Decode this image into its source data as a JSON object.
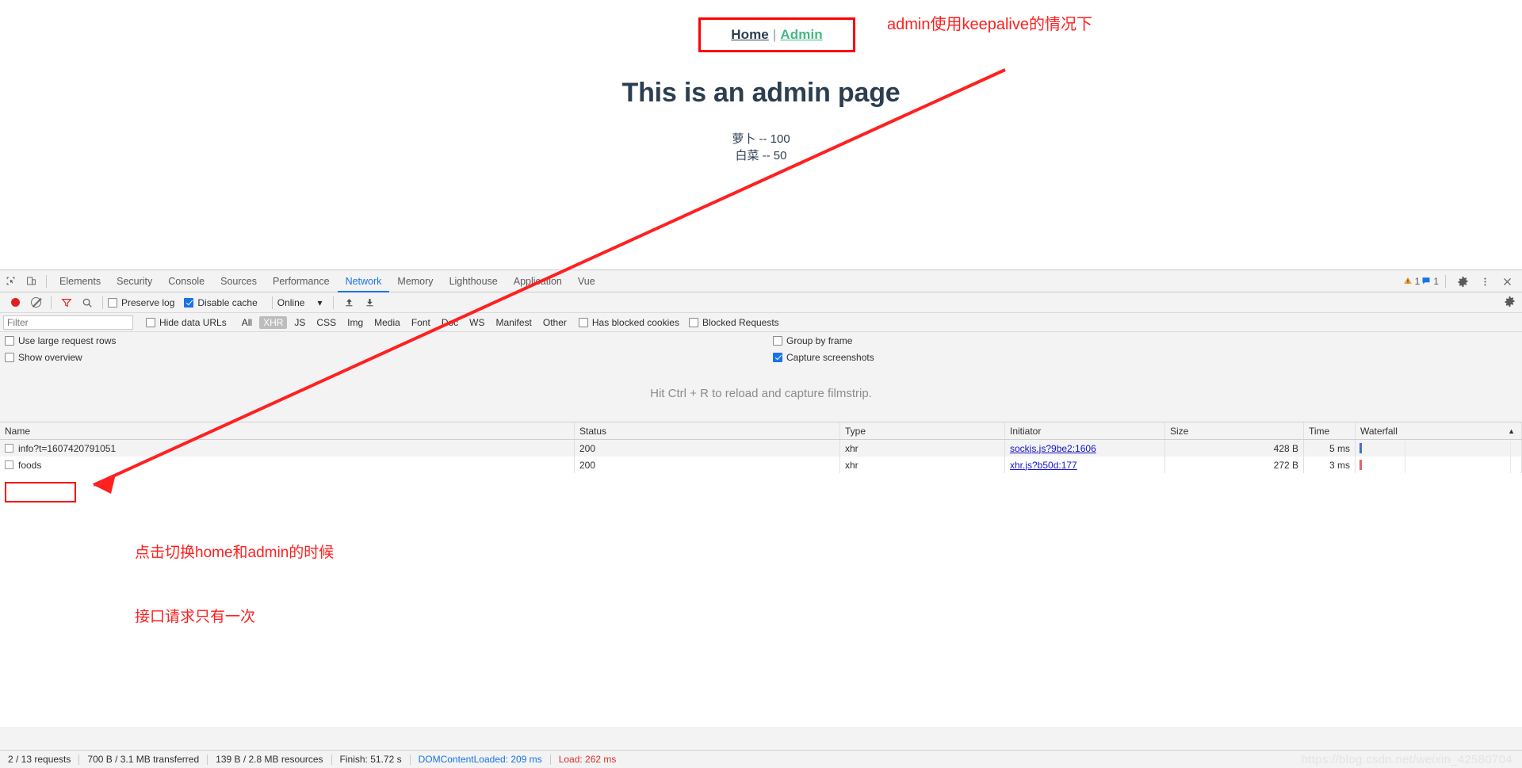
{
  "page": {
    "nav": {
      "home_label": "Home",
      "separator": "|",
      "admin_label": "Admin"
    },
    "heading": "This is an admin page",
    "foods": [
      "萝卜 -- 100",
      "白菜 -- 50"
    ]
  },
  "annotations": {
    "top": "admin使用keepalive的情况下",
    "bottom_line1": "点击切换home和admin的时候",
    "bottom_line2": "接口请求只有一次",
    "color": "#ff2020"
  },
  "devtools": {
    "tabs": [
      {
        "label": "Elements",
        "active": false
      },
      {
        "label": "Security",
        "active": false
      },
      {
        "label": "Console",
        "active": false
      },
      {
        "label": "Sources",
        "active": false
      },
      {
        "label": "Performance",
        "active": false
      },
      {
        "label": "Network",
        "active": true
      },
      {
        "label": "Memory",
        "active": false
      },
      {
        "label": "Lighthouse",
        "active": false
      },
      {
        "label": "Application",
        "active": false
      },
      {
        "label": "Vue",
        "active": false
      }
    ],
    "tabbar_right": {
      "warning_count": "1",
      "message_count": "1",
      "warning_icon": "warning-triangle-icon",
      "message_icon": "message-bubble-icon",
      "settings_icon": "gear-icon",
      "more_icon": "kebab-menu-icon",
      "close_icon": "close-icon"
    },
    "toolbar": {
      "record_icon": "record-dot-icon",
      "clear_icon": "clear-icon",
      "filter_icon": "funnel-icon",
      "search_icon": "search-icon",
      "preserve_log_label": "Preserve log",
      "preserve_log_checked": false,
      "disable_cache_label": "Disable cache",
      "disable_cache_checked": true,
      "throttle_value": "Online",
      "import_icon": "upload-arrow-icon",
      "export_icon": "download-arrow-icon",
      "settings_icon": "gear-icon"
    },
    "filterbar": {
      "filter_placeholder": "Filter",
      "filter_value": "",
      "hide_data_urls_label": "Hide data URLs",
      "hide_data_urls_checked": false,
      "types": [
        {
          "label": "All",
          "selected": false
        },
        {
          "label": "XHR",
          "selected": true
        },
        {
          "label": "JS",
          "selected": false
        },
        {
          "label": "CSS",
          "selected": false
        },
        {
          "label": "Img",
          "selected": false
        },
        {
          "label": "Media",
          "selected": false
        },
        {
          "label": "Font",
          "selected": false
        },
        {
          "label": "Doc",
          "selected": false
        },
        {
          "label": "WS",
          "selected": false
        },
        {
          "label": "Manifest",
          "selected": false
        },
        {
          "label": "Other",
          "selected": false
        }
      ],
      "has_blocked_cookies_label": "Has blocked cookies",
      "has_blocked_cookies_checked": false,
      "blocked_requests_label": "Blocked Requests",
      "blocked_requests_checked": false
    },
    "options": {
      "use_large_request_rows_label": "Use large request rows",
      "use_large_request_rows_checked": false,
      "show_overview_label": "Show overview",
      "show_overview_checked": false,
      "group_by_frame_label": "Group by frame",
      "group_by_frame_checked": false,
      "capture_screenshots_label": "Capture screenshots",
      "capture_screenshots_checked": true
    },
    "filmstrip_message": "Hit Ctrl + R to reload and capture filmstrip.",
    "table": {
      "columns": [
        "Name",
        "Status",
        "Type",
        "Initiator",
        "Size",
        "Time",
        "Waterfall"
      ],
      "rows": [
        {
          "name": "info?t=1607420791051",
          "status": "200",
          "type": "xhr",
          "initiator": "sockjs.js?9be2:1606",
          "size": "428 B",
          "time": "5 ms"
        },
        {
          "name": "foods",
          "status": "200",
          "type": "xhr",
          "initiator": "xhr.js?b50d:177",
          "size": "272 B",
          "time": "3 ms"
        }
      ]
    },
    "status": {
      "requests": "2 / 13 requests",
      "transferred": "700 B / 3.1 MB transferred",
      "resources": "139 B / 2.8 MB resources",
      "finish": "Finish: 51.72 s",
      "domcontentloaded": "DOMContentLoaded: 209 ms",
      "load": "Load: 262 ms"
    }
  },
  "watermark": "https://blog.csdn.net/weixin_42580704"
}
